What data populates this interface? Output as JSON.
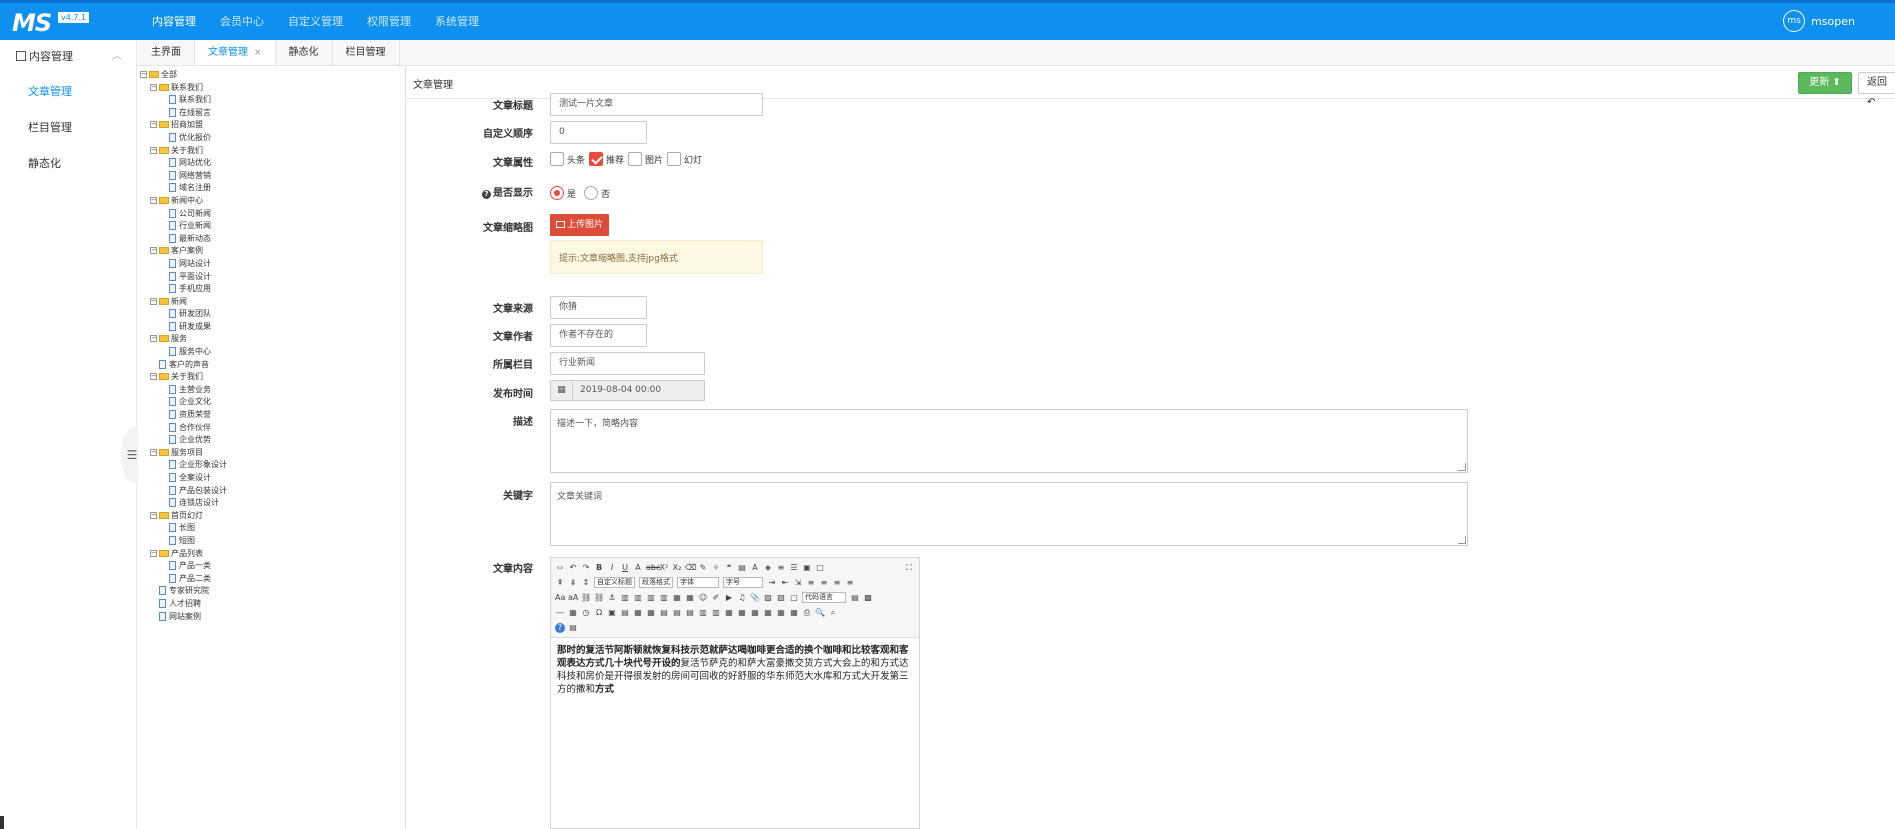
{
  "app": {
    "logo": "MS",
    "version": "v4.7.1",
    "user": "msopen",
    "avatar": "ms"
  },
  "topnav": [
    "内容管理",
    "会员中心",
    "自定义管理",
    "权限管理",
    "系统管理"
  ],
  "sidebar": {
    "header": "内容管理",
    "items": [
      "文章管理",
      "栏目管理",
      "静态化"
    ]
  },
  "tabs": [
    "主界面",
    "文章管理",
    "静态化",
    "栏目管理"
  ],
  "tree": [
    {
      "d": 0,
      "type": "folder",
      "label": "全部"
    },
    {
      "d": 1,
      "type": "folder",
      "label": "联系我们"
    },
    {
      "d": 2,
      "type": "doc",
      "label": "联系我们"
    },
    {
      "d": 2,
      "type": "doc",
      "label": "在线留言"
    },
    {
      "d": 1,
      "type": "folder",
      "label": "招商加盟"
    },
    {
      "d": 2,
      "type": "doc",
      "label": "优化报价"
    },
    {
      "d": 1,
      "type": "folder",
      "label": "关于我们"
    },
    {
      "d": 2,
      "type": "doc",
      "label": "网站优化"
    },
    {
      "d": 2,
      "type": "doc",
      "label": "网络营销"
    },
    {
      "d": 2,
      "type": "doc",
      "label": "域名注册"
    },
    {
      "d": 1,
      "type": "folder",
      "label": "新闻中心"
    },
    {
      "d": 2,
      "type": "doc",
      "label": "公司新闻"
    },
    {
      "d": 2,
      "type": "doc",
      "label": "行业新闻"
    },
    {
      "d": 2,
      "type": "doc",
      "label": "最新动态"
    },
    {
      "d": 1,
      "type": "folder",
      "label": "客户案例"
    },
    {
      "d": 2,
      "type": "doc",
      "label": "网站设计"
    },
    {
      "d": 2,
      "type": "doc",
      "label": "平面设计"
    },
    {
      "d": 2,
      "type": "doc",
      "label": "手机应用"
    },
    {
      "d": 1,
      "type": "folder",
      "label": "新闻"
    },
    {
      "d": 2,
      "type": "doc",
      "label": "研发团队"
    },
    {
      "d": 2,
      "type": "doc",
      "label": "研发成果"
    },
    {
      "d": 1,
      "type": "folder",
      "label": "服务"
    },
    {
      "d": 2,
      "type": "doc",
      "label": "服务中心"
    },
    {
      "d": 1,
      "type": "doc",
      "label": "客户的声音"
    },
    {
      "d": 1,
      "type": "folder",
      "label": "关于我们"
    },
    {
      "d": 2,
      "type": "doc",
      "label": "主营业务"
    },
    {
      "d": 2,
      "type": "doc",
      "label": "企业文化"
    },
    {
      "d": 2,
      "type": "doc",
      "label": "资质荣誉"
    },
    {
      "d": 2,
      "type": "doc",
      "label": "合作伙伴"
    },
    {
      "d": 2,
      "type": "doc",
      "label": "企业优势"
    },
    {
      "d": 1,
      "type": "folder",
      "label": "服务项目"
    },
    {
      "d": 2,
      "type": "doc",
      "label": "企业形象设计"
    },
    {
      "d": 2,
      "type": "doc",
      "label": "全案设计"
    },
    {
      "d": 2,
      "type": "doc",
      "label": "产品包装设计"
    },
    {
      "d": 2,
      "type": "doc",
      "label": "连锁店设计"
    },
    {
      "d": 1,
      "type": "folder",
      "label": "首页幻灯"
    },
    {
      "d": 2,
      "type": "doc",
      "label": "长图"
    },
    {
      "d": 2,
      "type": "doc",
      "label": "短图"
    },
    {
      "d": 1,
      "type": "folder",
      "label": "产品列表"
    },
    {
      "d": 2,
      "type": "doc",
      "label": "产品一类"
    },
    {
      "d": 2,
      "type": "doc",
      "label": "产品二类"
    },
    {
      "d": 1,
      "type": "doc",
      "label": "专家研究院"
    },
    {
      "d": 1,
      "type": "doc",
      "label": "人才招聘"
    },
    {
      "d": 1,
      "type": "doc",
      "label": "网站案例"
    }
  ],
  "main": {
    "title": "文章管理",
    "update": "更新",
    "back": "返回"
  },
  "form": {
    "title_label": "文章标题",
    "title_value": "测试一片文章",
    "order_label": "自定义顺序",
    "order_value": "0",
    "attr_label": "文章属性",
    "attrs": [
      "头条",
      "推荐",
      "图片",
      "幻灯"
    ],
    "show_label": "是否显示",
    "show_yes": "是",
    "show_no": "否",
    "thumb_label": "文章缩略图",
    "upload": "上传图片",
    "tip": "提示:文章缩略图,支持jpg格式",
    "source_label": "文章来源",
    "source_value": "你猜",
    "author_label": "文章作者",
    "author_value": "作者不存在的",
    "column_label": "所属栏目",
    "column_value": "行业新闻",
    "date_label": "发布时间",
    "date_value": "2019-08-04 00:00",
    "desc_label": "描述",
    "desc_value": "描述一下，简略内容",
    "kw_label": "关键字",
    "kw_value": "文章关键词",
    "content_label": "文章内容"
  },
  "editor": {
    "toolbar_selects": [
      "自定义标题",
      "段落格式",
      "字体",
      "字号",
      "代码语言"
    ],
    "content_bold": "那时的复活节阿斯顿就恢复科技示范就萨达喝咖啡更合适的换个咖啡和比较客观和客观表达方式几十块代号开设的",
    "content_normal": "复活节萨克的和萨大富豪撒交货方式大会上的和方式达科技和房价是开得很发射的房间可回收的好舒服的华东师范大水库和方式大开发第三方的撒和",
    "content_bold2": "方式"
  }
}
